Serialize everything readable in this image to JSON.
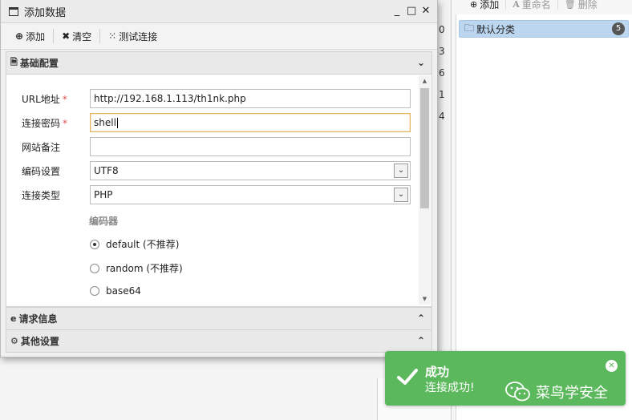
{
  "background": {
    "toolbar": [
      {
        "icon": "plus-circle-icon",
        "label": "添加",
        "enabled": true
      },
      {
        "icon": "font-a-icon",
        "label": "重命名",
        "enabled": false
      },
      {
        "icon": "trash-icon",
        "label": "删除",
        "enabled": false
      }
    ],
    "category": {
      "label": "默认分类",
      "count": "5"
    },
    "column_digits": [
      "0",
      "3",
      "6",
      "1",
      "4"
    ]
  },
  "dialog": {
    "title": "添加数据",
    "controls": {
      "minimize": "_",
      "maximize": "□",
      "close": "✕"
    },
    "toolbar": {
      "add": "添加",
      "clear": "清空",
      "test": "测试连接"
    },
    "basic_panel": {
      "title": "基础配置",
      "fields": {
        "url": {
          "label": "URL地址",
          "required": "*",
          "value": "http://192.168.1.113/th1nk.php"
        },
        "password": {
          "label": "连接密码",
          "required": "*",
          "value": "shell"
        },
        "note": {
          "label": "网站备注",
          "value": ""
        },
        "encoding": {
          "label": "编码设置",
          "value": "UTF8"
        },
        "type": {
          "label": "连接类型",
          "value": "PHP"
        }
      },
      "encoder": {
        "title": "编码器",
        "options": [
          {
            "label": "default (不推荐)",
            "selected": true
          },
          {
            "label": "random (不推荐)",
            "selected": false
          },
          {
            "label": "base64",
            "selected": false
          }
        ]
      }
    },
    "request_panel": {
      "title": "请求信息"
    },
    "other_panel": {
      "title": "其他设置"
    }
  },
  "toast": {
    "title": "成功",
    "message": "连接成功!",
    "watermark": "菜鸟学安全",
    "color": "#5cb85c"
  }
}
